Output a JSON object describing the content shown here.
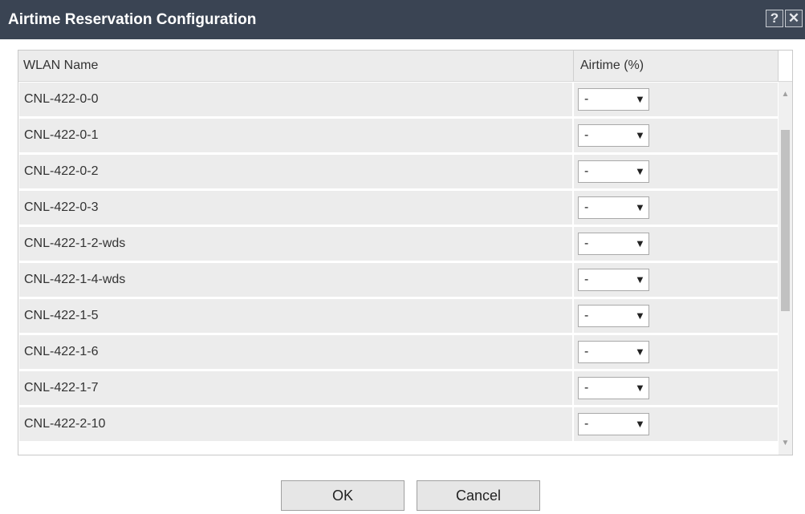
{
  "dialog": {
    "title": "Airtime Reservation Configuration",
    "help_label": "?",
    "close_label": "✕"
  },
  "table": {
    "columns": [
      "WLAN Name",
      "Airtime (%)"
    ],
    "rows": [
      {
        "name": "CNL-422-0-0",
        "airtime": "-"
      },
      {
        "name": "CNL-422-0-1",
        "airtime": "-"
      },
      {
        "name": "CNL-422-0-2",
        "airtime": "-"
      },
      {
        "name": "CNL-422-0-3",
        "airtime": "-"
      },
      {
        "name": "CNL-422-1-2-wds",
        "airtime": "-"
      },
      {
        "name": "CNL-422-1-4-wds",
        "airtime": "-"
      },
      {
        "name": "CNL-422-1-5",
        "airtime": "-"
      },
      {
        "name": "CNL-422-1-6",
        "airtime": "-"
      },
      {
        "name": "CNL-422-1-7",
        "airtime": "-"
      },
      {
        "name": "CNL-422-2-10",
        "airtime": "-"
      }
    ],
    "dropdown_arrow": "▼",
    "scroll_up": "▲",
    "scroll_down": "▼"
  },
  "buttons": {
    "ok_label": "OK",
    "cancel_label": "Cancel"
  },
  "colors": {
    "titlebar": "#3a4453",
    "row_bg": "#ececec"
  }
}
